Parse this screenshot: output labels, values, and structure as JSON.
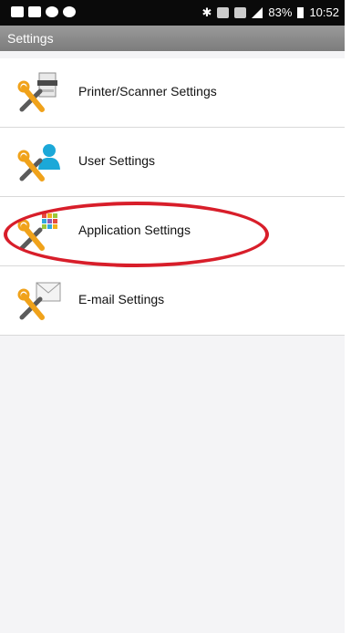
{
  "status_bar": {
    "battery": "83%",
    "time": "10:52"
  },
  "header": {
    "title": "Settings"
  },
  "menu": {
    "items": [
      {
        "label": "Printer/Scanner Settings",
        "icon": "printer-tools-icon"
      },
      {
        "label": "User Settings",
        "icon": "user-tools-icon"
      },
      {
        "label": "Application Settings",
        "icon": "apps-tools-icon"
      },
      {
        "label": "E-mail Settings",
        "icon": "email-tools-icon"
      }
    ]
  },
  "colors": {
    "annotation": "#d81e2a",
    "tool_orange": "#f0a21a",
    "tool_blue": "#1ba8d8"
  }
}
